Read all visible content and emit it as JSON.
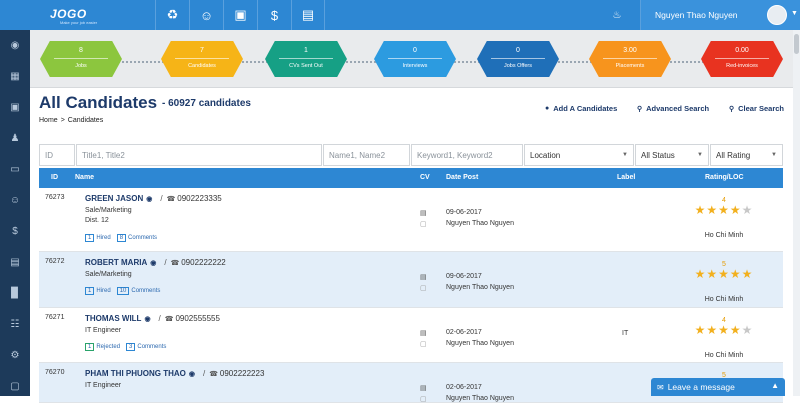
{
  "brand": {
    "name": "JOGO",
    "tagline": "Make your job easier"
  },
  "nav": {
    "icons": [
      "briefcase-bag-icon",
      "users-icon",
      "briefcase-icon",
      "dollar-icon",
      "document-icon"
    ]
  },
  "user": {
    "name": "Nguyen Thao Nguyen"
  },
  "stats": [
    {
      "value": "8",
      "label": "Jobs",
      "color": "#8cc63e"
    },
    {
      "value": "7",
      "label": "Candidates",
      "color": "#f6b417"
    },
    {
      "value": "1",
      "label": "CVs Sent Out",
      "color": "#16a085"
    },
    {
      "value": "0",
      "label": "Interviews",
      "color": "#2c9be0"
    },
    {
      "value": "0",
      "label": "Jobs Offers",
      "color": "#1f6fb8"
    },
    {
      "value": "3.00",
      "label": "Placements",
      "color": "#f7941d"
    },
    {
      "value": "0.00",
      "label": "Red-invoices",
      "color": "#e83320"
    }
  ],
  "page": {
    "title": "All Candidates",
    "subtitle": "- 60927 candidates",
    "breadcrumb_home": "Home",
    "breadcrumb_current": "Candidates"
  },
  "actions": {
    "add": "Add A Candidates",
    "advanced": "Advanced Search",
    "clear": "Clear Search"
  },
  "filters": {
    "id": "ID",
    "title": "Title1, Title2",
    "name": "Name1, Name2",
    "keyword": "Keyword1, Keyword2",
    "location": "Location",
    "status": "All Status",
    "rating": "All Rating"
  },
  "columns": {
    "id": "ID",
    "name": "Name",
    "cv": "CV",
    "date": "Date Post",
    "label": "Label",
    "rating": "Rating/LOC"
  },
  "candidates": [
    {
      "id": "76273",
      "name": "GREEN JASON",
      "phone": "0902223335",
      "role": "Sale/Marketing",
      "district": "Dist. 12",
      "status_count": "1",
      "status": "Hired",
      "comment_count": "8",
      "comment_label": "Comments",
      "date": "09-06-2017",
      "by": "Nguyen Thao Nguyen",
      "label": "",
      "rating": "4",
      "stars": 4,
      "location": "Ho Chi Minh"
    },
    {
      "id": "76272",
      "name": "ROBERT MARIA",
      "phone": "0902222222",
      "role": "Sale/Marketing",
      "district": "",
      "status_count": "1",
      "status": "Hired",
      "comment_count": "10",
      "comment_label": "Comments",
      "date": "09-06-2017",
      "by": "Nguyen Thao Nguyen",
      "label": "",
      "rating": "5",
      "stars": 5,
      "location": "Ho Chi Minh"
    },
    {
      "id": "76271",
      "name": "THOMAS WILL",
      "phone": "0902555555",
      "role": "IT Engineer",
      "district": "",
      "status_count": "1",
      "status": "Rejected",
      "comment_count": "3",
      "comment_label": "Comments",
      "date": "02-06-2017",
      "by": "Nguyen Thao Nguyen",
      "label": "IT",
      "rating": "4",
      "stars": 4,
      "location": "Ho Chi Minh"
    },
    {
      "id": "76270",
      "name": "PHAM THI PHUONG THAO",
      "phone": "0902222223",
      "role": "IT Engineer",
      "district": "",
      "status_count": "",
      "status": "",
      "comment_count": "",
      "comment_label": "",
      "date": "02-06-2017",
      "by": "Nguyen Thao Nguyen",
      "label": "",
      "rating": "5",
      "stars": 5,
      "location": ""
    }
  ],
  "chat": {
    "label": "Leave a message"
  }
}
